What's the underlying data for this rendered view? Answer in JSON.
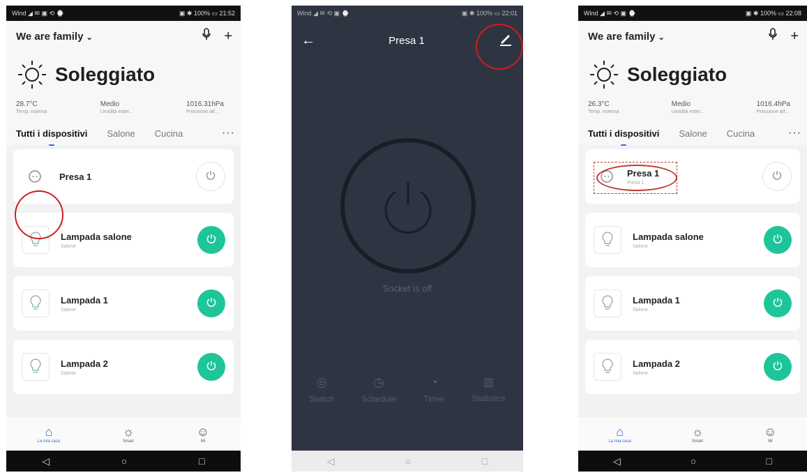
{
  "screens": [
    {
      "status_left": "Wind ◢ ✉ ▣ ⟲ ⌚",
      "status_right": "▣ ✱ 100% ▭ 21:52",
      "home_name": "We are family",
      "weather": {
        "title": "Soleggiato",
        "temp": "28.7°C",
        "temp_label": "Temp. esterna",
        "humidity": "Medio",
        "humidity_label": "Umidità ester...",
        "pressure": "1016.31hPa",
        "pressure_label": "Pressione atf..."
      },
      "tabs": [
        "Tutti i dispositivi",
        "Salone",
        "Cucina"
      ],
      "devices": [
        {
          "name": "Presa 1",
          "room": "",
          "on": false
        },
        {
          "name": "Lampada salone",
          "room": "Salone",
          "on": true
        },
        {
          "name": "Lampada 1",
          "room": "Salone",
          "on": true
        },
        {
          "name": "Lampada 2",
          "room": "Salone",
          "on": true
        }
      ],
      "nav": [
        "La mia casa",
        "Smart",
        "Mi"
      ]
    },
    {
      "status_left": "Wind ◢ ✉ ⟲ ▣ ⌚",
      "status_right": "▣ ✱ 100% ▭ 22:01",
      "title": "Presa 1",
      "socket_status": "Socket is off",
      "tools": [
        "Switch",
        "Schedule",
        "Timer",
        "Statistics"
      ]
    },
    {
      "status_left": "Wind ◢ ✉ ⟲ ▣ ⌚",
      "status_right": "▣ ✱ 100% ▭ 22:08",
      "home_name": "We are family",
      "weather": {
        "title": "Soleggiato",
        "temp": "26.3°C",
        "temp_label": "Temp. esterna",
        "humidity": "Medio",
        "humidity_label": "Umidità ester...",
        "pressure": "1016.4hPa",
        "pressure_label": "Pressione atf..."
      },
      "tabs": [
        "Tutti i dispositivi",
        "Salone",
        "Cucina"
      ],
      "devices": [
        {
          "name": "Presa 1",
          "room": "Presa 1",
          "on": false
        },
        {
          "name": "Lampada salone",
          "room": "Salone",
          "on": true
        },
        {
          "name": "Lampada 1",
          "room": "Salone",
          "on": true
        },
        {
          "name": "Lampada 2",
          "room": "Salone",
          "on": true
        }
      ],
      "nav": [
        "La mia casa",
        "Smart",
        "Mi"
      ]
    }
  ],
  "colors": {
    "accent": "#1fc59a",
    "nav_active": "#2a6fe0",
    "annotation": "#d01c1c",
    "detail_bg": "#2f3443"
  },
  "icons": {
    "mic": "microphone-icon",
    "add": "plus-icon",
    "back": "arrow-left-icon",
    "edit": "pencil-icon",
    "sun": "sun-icon",
    "power": "power-icon"
  }
}
